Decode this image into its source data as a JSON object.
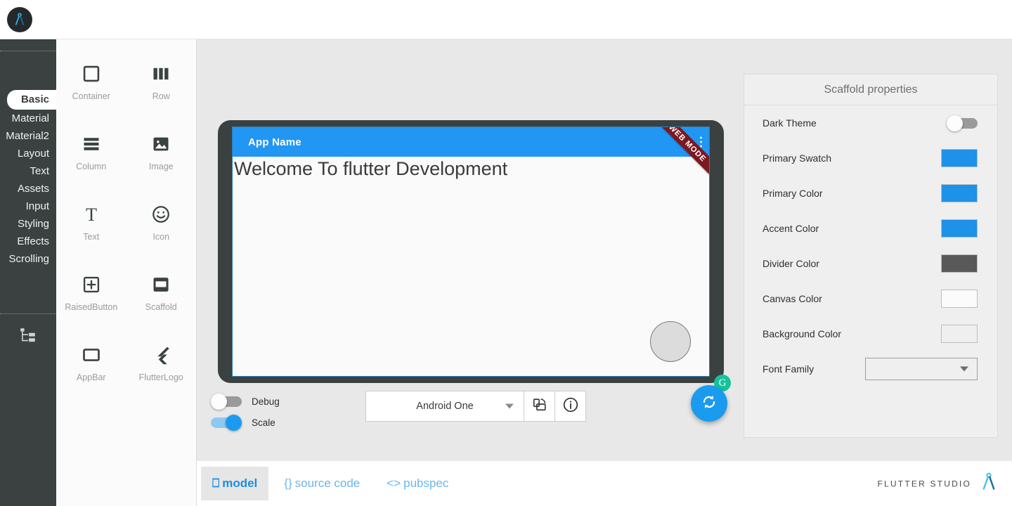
{
  "header": {
    "logo_icon": "compass-logo-icon"
  },
  "sidebar": {
    "tabs": [
      {
        "label": "Basic",
        "active": true
      },
      {
        "label": "Material",
        "active": false
      },
      {
        "label": "Material2",
        "active": false
      },
      {
        "label": "Layout",
        "active": false
      },
      {
        "label": "Text",
        "active": false
      },
      {
        "label": "Assets",
        "active": false
      },
      {
        "label": "Input",
        "active": false
      },
      {
        "label": "Styling",
        "active": false
      },
      {
        "label": "Effects",
        "active": false
      },
      {
        "label": "Scrolling",
        "active": false
      }
    ],
    "tree_icon": "widget-tree-icon"
  },
  "palette": {
    "items": [
      {
        "label": "Container",
        "icon": "container-icon"
      },
      {
        "label": "Row",
        "icon": "row-icon"
      },
      {
        "label": "Column",
        "icon": "column-icon"
      },
      {
        "label": "Image",
        "icon": "image-icon"
      },
      {
        "label": "Text",
        "icon": "text-icon"
      },
      {
        "label": "Icon",
        "icon": "emoji-icon"
      },
      {
        "label": "RaisedButton",
        "icon": "raised-button-icon"
      },
      {
        "label": "Scaffold",
        "icon": "scaffold-icon"
      },
      {
        "label": "AppBar",
        "icon": "appbar-icon"
      },
      {
        "label": "FlutterLogo",
        "icon": "flutter-logo-icon"
      }
    ]
  },
  "preview": {
    "app_bar_title": "App Name",
    "ribbon_label": "WEB MODE",
    "body_text": "Welcome To flutter Development",
    "overflow_icon": "overflow-menu-icon",
    "fab_placeholder": "floating-action-button-placeholder",
    "grammarly_badge": "G"
  },
  "controls": {
    "debug": {
      "label": "Debug",
      "on": false
    },
    "scale": {
      "label": "Scale",
      "on": true
    },
    "device": {
      "value": "Android One"
    },
    "rotate_icon": "rotate-device-icon",
    "info_icon": "info-icon",
    "refresh_icon": "refresh-icon"
  },
  "properties": {
    "title": "Scaffold properties",
    "rows": [
      {
        "label": "Dark Theme",
        "type": "switch",
        "on": false
      },
      {
        "label": "Primary Swatch",
        "type": "color",
        "color": "#1e91e8"
      },
      {
        "label": "Primary Color",
        "type": "color",
        "color": "#1e91e8"
      },
      {
        "label": "Accent Color",
        "type": "color",
        "color": "#1e91e8"
      },
      {
        "label": "Divider Color",
        "type": "color",
        "color": "#595959"
      },
      {
        "label": "Canvas Color",
        "type": "color",
        "color": "#fbfbfb"
      },
      {
        "label": "Background Color",
        "type": "color",
        "color": "#efefef"
      },
      {
        "label": "Font Family",
        "type": "select",
        "value": ""
      }
    ]
  },
  "bottom_tabs": [
    {
      "label": "model",
      "icon": "phone-icon",
      "glyph": "⎕",
      "active": true
    },
    {
      "label": "source code",
      "icon": "braces-icon",
      "glyph": "{}",
      "active": false
    },
    {
      "label": "pubspec",
      "icon": "code-tags-icon",
      "glyph": "<>",
      "active": false
    }
  ],
  "footer": {
    "brand": "FLUTTER STUDIO",
    "brand_icon": "compass-logo-icon"
  },
  "colors": {
    "accent_blue": "#2196f3",
    "rail_dark": "#3a4140",
    "ribbon_red": "#7b1822",
    "grammarly_green": "#15c39a"
  }
}
